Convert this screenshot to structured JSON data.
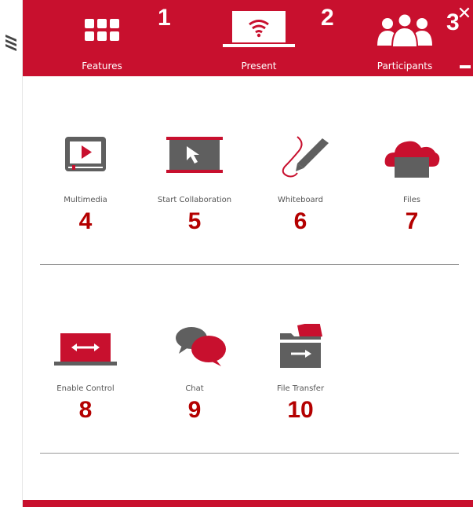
{
  "colors": {
    "brand": "#c8102e",
    "icon_gray": "#5f5f5f",
    "marker_red": "#b40000"
  },
  "header": {
    "tabs": [
      {
        "label": "Features",
        "icon": "grid-icon",
        "marker": "1"
      },
      {
        "label": "Present",
        "icon": "wireless-present-icon",
        "marker": "2"
      },
      {
        "label": "Participants",
        "icon": "participants-icon",
        "marker": "3"
      }
    ],
    "close_glyph": "✕"
  },
  "features": [
    {
      "label": "Multimedia",
      "marker": "4",
      "icon": "multimedia-icon"
    },
    {
      "label": "Start Collaboration",
      "marker": "5",
      "icon": "collaboration-icon"
    },
    {
      "label": "Whiteboard",
      "marker": "6",
      "icon": "whiteboard-pen-icon"
    },
    {
      "label": "Files",
      "marker": "7",
      "icon": "cloud-files-icon"
    },
    {
      "label": "Enable Control",
      "marker": "8",
      "icon": "enable-control-icon"
    },
    {
      "label": "Chat",
      "marker": "9",
      "icon": "chat-icon"
    },
    {
      "label": "File Transfer",
      "marker": "10",
      "icon": "file-transfer-icon"
    }
  ]
}
